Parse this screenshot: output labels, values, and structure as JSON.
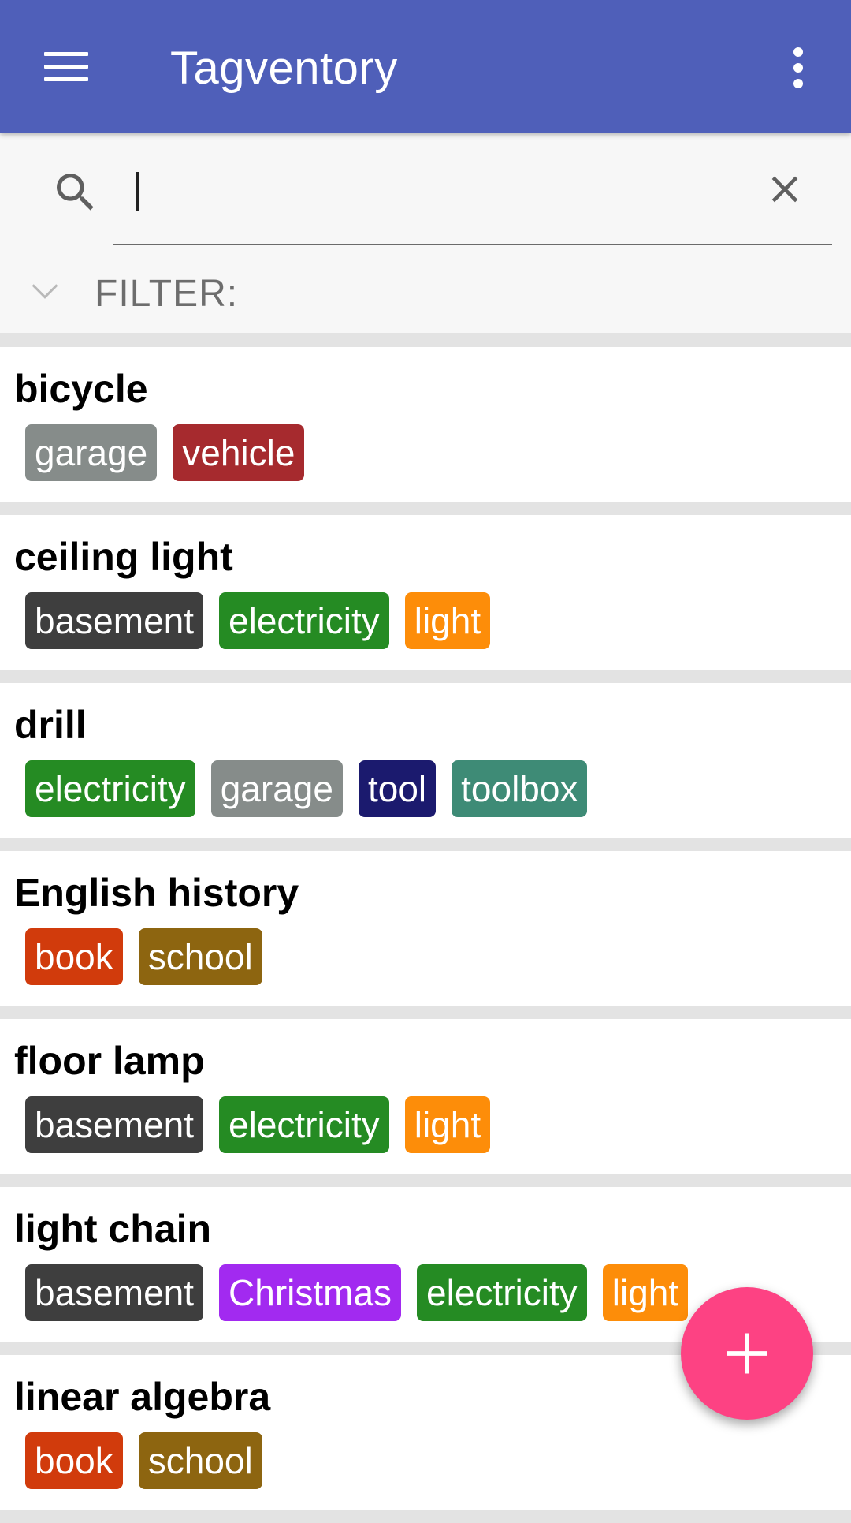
{
  "app": {
    "title": "Tagventory"
  },
  "search": {
    "value": "",
    "placeholder": ""
  },
  "filter": {
    "label": "FILTER:"
  },
  "items": [
    {
      "name": "bicycle",
      "tags": [
        {
          "label": "garage",
          "color": "#868c8a"
        },
        {
          "label": "vehicle",
          "color": "#a62a2e"
        }
      ]
    },
    {
      "name": "ceiling light",
      "tags": [
        {
          "label": "basement",
          "color": "#3e3e3e"
        },
        {
          "label": "electricity",
          "color": "#258b23"
        },
        {
          "label": "light",
          "color": "#fd8d09"
        }
      ]
    },
    {
      "name": "drill",
      "tags": [
        {
          "label": "electricity",
          "color": "#258b23"
        },
        {
          "label": "garage",
          "color": "#868c8a"
        },
        {
          "label": "tool",
          "color": "#1b1a6e"
        },
        {
          "label": "toolbox",
          "color": "#3e8b76"
        }
      ]
    },
    {
      "name": "English history",
      "tags": [
        {
          "label": "book",
          "color": "#d13b0c"
        },
        {
          "label": "school",
          "color": "#8d6510"
        }
      ]
    },
    {
      "name": "floor lamp",
      "tags": [
        {
          "label": "basement",
          "color": "#3e3e3e"
        },
        {
          "label": "electricity",
          "color": "#258b23"
        },
        {
          "label": "light",
          "color": "#fd8d09"
        }
      ]
    },
    {
      "name": "light chain",
      "tags": [
        {
          "label": "basement",
          "color": "#3e3e3e"
        },
        {
          "label": "Christmas",
          "color": "#a22af0"
        },
        {
          "label": "electricity",
          "color": "#258b23"
        },
        {
          "label": "light",
          "color": "#fd8d09"
        }
      ]
    },
    {
      "name": "linear algebra",
      "tags": [
        {
          "label": "book",
          "color": "#d13b0c"
        },
        {
          "label": "school",
          "color": "#8d6510"
        }
      ]
    }
  ],
  "colors": {
    "appbar": "#4f5fb9",
    "fab": "#fd4283"
  },
  "icons": {
    "menu": "hamburger-menu-icon",
    "more": "more-vert-icon",
    "search": "search-icon",
    "clear": "close-icon",
    "filter": "chevron-down-icon",
    "add": "plus-icon"
  }
}
